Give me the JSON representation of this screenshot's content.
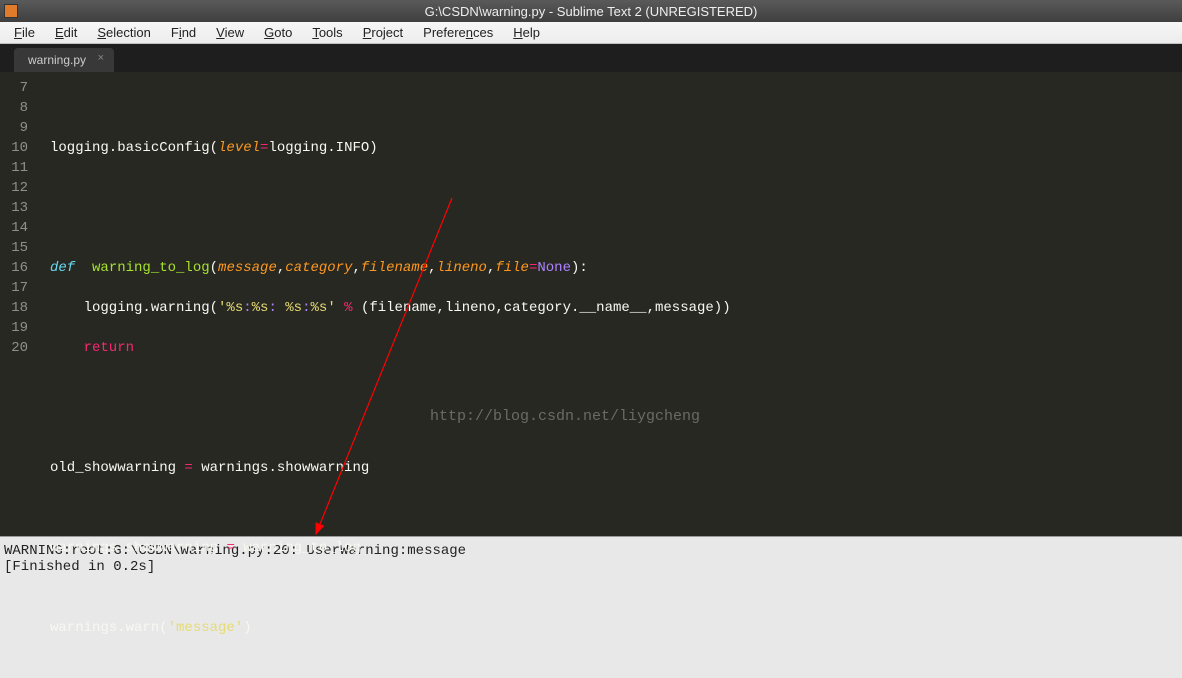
{
  "title": "G:\\CSDN\\warning.py - Sublime Text 2 (UNREGISTERED)",
  "menu": {
    "file": "File",
    "edit": "Edit",
    "selection": "Selection",
    "find": "Find",
    "view": "View",
    "goto": "Goto",
    "tools": "Tools",
    "project": "Project",
    "preferences": "Preferences",
    "help": "Help"
  },
  "tab": {
    "name": "warning.py",
    "close": "×"
  },
  "gutter": [
    "7",
    "8",
    "9",
    "10",
    "11",
    "12",
    "13",
    "14",
    "15",
    "16",
    "17",
    "18",
    "19",
    "20"
  ],
  "code": {
    "l8_a": "logging.basicConfig(",
    "l8_b": "level",
    "l8_c": "=",
    "l8_d": "logging.INFO)",
    "l11_def": "def",
    "l11_fn": "  warning_to_log",
    "l11_p1": "message",
    "l11_p2": "category",
    "l11_p3": "filename",
    "l11_p4": "lineno",
    "l11_p5": "file",
    "l11_none": "None",
    "l12_a": "    logging.warning(",
    "l12_s1": "'%s",
    "l12_s2": ":",
    "l12_s3": "%s",
    "l12_s4": ": ",
    "l12_s5": "%s",
    "l12_s6": ":",
    "l12_s7": "%s",
    "l12_s8": "'",
    "l12_op": " % ",
    "l12_b": "(filename,lineno,category.__name__,message))",
    "l13": "    return",
    "l16_a": "old_showwarning ",
    "l16_eq": "=",
    "l16_b": " warnings.showwarning",
    "l18_a": "warnings.showwarning ",
    "l18_eq": "=",
    "l18_b": " warning_to_log",
    "l20_a": "warnings.warn(",
    "l20_s": "'message'",
    "l20_b": ")"
  },
  "watermark": "http://blog.csdn.net/liygcheng",
  "output": {
    "line1": "WARNING:root:G:\\CSDN\\warning.py:20: UserWarning:message",
    "line2": "[Finished in 0.2s]"
  }
}
